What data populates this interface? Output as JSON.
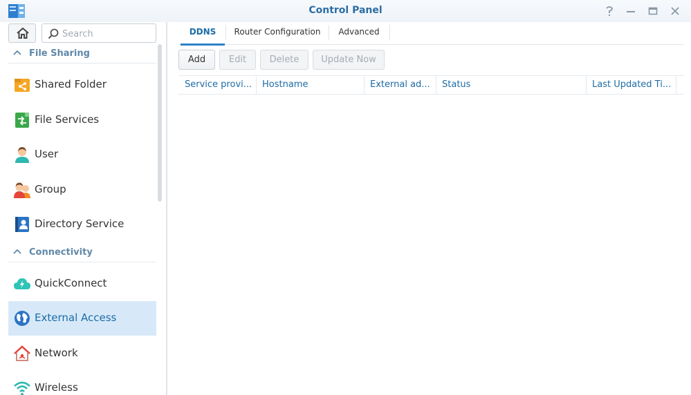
{
  "window": {
    "title": "Control Panel",
    "controls": {
      "help": "help-icon",
      "minimize": "minimize-icon",
      "maximize": "maximize-icon",
      "close": "close-icon"
    }
  },
  "sidebar": {
    "search_placeholder": "Search",
    "sections": [
      {
        "label": "File Sharing",
        "items": [
          {
            "label": "Shared Folder",
            "icon": "shared-folder-icon"
          },
          {
            "label": "File Services",
            "icon": "file-services-icon"
          },
          {
            "label": "User",
            "icon": "user-icon"
          },
          {
            "label": "Group",
            "icon": "group-icon"
          },
          {
            "label": "Directory Service",
            "icon": "directory-service-icon"
          }
        ]
      },
      {
        "label": "Connectivity",
        "items": [
          {
            "label": "QuickConnect",
            "icon": "quickconnect-icon"
          },
          {
            "label": "External Access",
            "icon": "external-access-icon",
            "selected": true
          },
          {
            "label": "Network",
            "icon": "network-icon"
          },
          {
            "label": "Wireless",
            "icon": "wireless-icon"
          }
        ]
      }
    ]
  },
  "main": {
    "tabs": [
      {
        "label": "DDNS",
        "active": true
      },
      {
        "label": "Router Configuration"
      },
      {
        "label": "Advanced"
      }
    ],
    "toolbar": {
      "add": "Add",
      "edit": "Edit",
      "delete": "Delete",
      "update_now": "Update Now"
    },
    "table": {
      "columns": [
        "Service provi...",
        "Hostname",
        "External ad...",
        "Status",
        "Last Updated Ti..."
      ],
      "rows": []
    }
  },
  "colors": {
    "accent": "#1d6ba6",
    "selected_bg": "#d7e9f8",
    "section_label": "#5f88a8"
  }
}
